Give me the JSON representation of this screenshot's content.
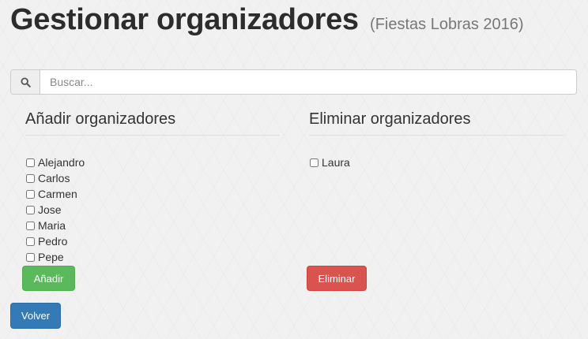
{
  "header": {
    "title": "Gestionar organizadores",
    "subtitle": "(Fiestas Lobras 2016)"
  },
  "search": {
    "icon": "search-icon",
    "placeholder": "Buscar..."
  },
  "add_section": {
    "heading": "Añadir organizadores",
    "items": [
      "Alejandro",
      "Carlos",
      "Carmen",
      "Jose",
      "Maria",
      "Pedro",
      "Pepe"
    ],
    "button_label": "Añadir"
  },
  "remove_section": {
    "heading": "Eliminar organizadores",
    "items": [
      "Laura"
    ],
    "button_label": "Eliminar"
  },
  "back_button": {
    "label": "Volver"
  },
  "colors": {
    "success": "#5cb85c",
    "danger": "#d9534f",
    "primary": "#337ab7"
  }
}
